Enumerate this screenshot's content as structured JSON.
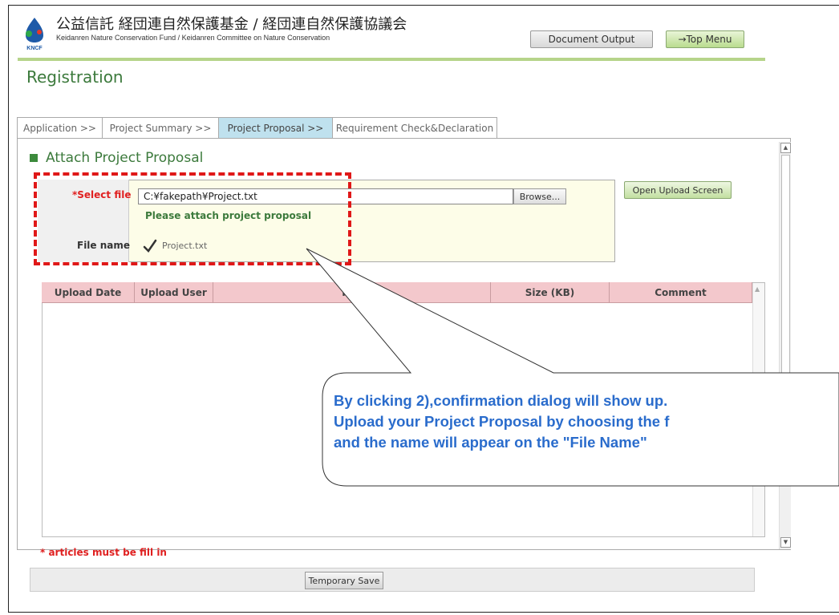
{
  "header": {
    "logo_text": "KNCF",
    "title_jp": "公益信託 経団連自然保護基金 / 経団連自然保護協議会",
    "title_en": "Keidanren Nature Conservation Fund / Keidanren Committee on Nature Conservation",
    "doc_output_label": "Document Output",
    "top_menu_label": "→Top Menu"
  },
  "page_title": "Registration",
  "tabs": [
    {
      "label": "Application >>"
    },
    {
      "label": "Project Summary >>"
    },
    {
      "label": "Project Proposal >>"
    },
    {
      "label": "Requirement Check&Declaration"
    }
  ],
  "section": {
    "title": "Attach Project Proposal"
  },
  "form": {
    "select_file_label": "*Select file",
    "file_value": "C:¥fakepath¥Project.txt",
    "browse_label": "Browse...",
    "hint": "Please attach project proposal",
    "file_name_label": "File name",
    "file_name_value": "Project.txt",
    "open_upload_label": "Open Upload Screen"
  },
  "table": {
    "columns": [
      "Upload Date",
      "Upload User",
      "File",
      "Size (KB)",
      "Comment"
    ],
    "rows": []
  },
  "required_note": "* articles must be fill in",
  "temp_save_label": "Temporary Save",
  "callout": {
    "line1": "By clicking 2),confirmation dialog will show up.",
    "line2": "Upload your Project Proposal by choosing the f",
    "line3": "and the name will appear on the \"File Name\""
  },
  "colors": {
    "accent_green": "#3c7a3c",
    "required_red": "#e02020",
    "callout_blue": "#2a6ccc",
    "active_tab": "#bfe1ee",
    "table_header": "#f3c8cc"
  }
}
